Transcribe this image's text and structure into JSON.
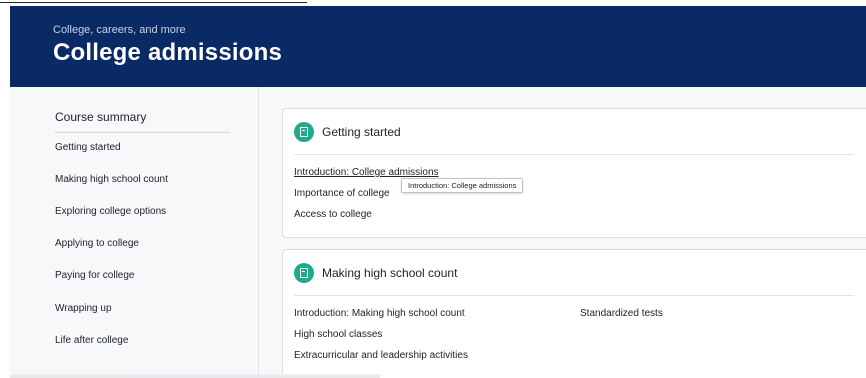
{
  "header": {
    "breadcrumb": "College, careers, and more",
    "title": "College admissions"
  },
  "sidebar": {
    "heading": "Course summary",
    "items": [
      {
        "label": "Getting started"
      },
      {
        "label": "Making high school count"
      },
      {
        "label": "Exploring college options"
      },
      {
        "label": "Applying to college"
      },
      {
        "label": "Paying for college"
      },
      {
        "label": "Wrapping up"
      },
      {
        "label": "Life after college"
      }
    ]
  },
  "units": [
    {
      "title": "Getting started",
      "icon": "unit-book-icon",
      "lessons": [
        {
          "label": "Introduction: College admissions"
        },
        {
          "label": "Importance of college"
        },
        {
          "label": "Access to college"
        }
      ]
    },
    {
      "title": "Making high school count",
      "icon": "unit-book-icon",
      "lessons": [
        {
          "label": "Introduction: Making high school count"
        },
        {
          "label": "High school classes"
        },
        {
          "label": "Extracurricular and leadership activities"
        },
        {
          "label": "Standardized tests"
        }
      ]
    }
  ],
  "tooltip": {
    "text": "Introduction: College admissions"
  },
  "colors": {
    "header_bg": "#0a2a66",
    "accent_green": "#1fab89",
    "sidebar_bg": "#f7f8fa"
  }
}
